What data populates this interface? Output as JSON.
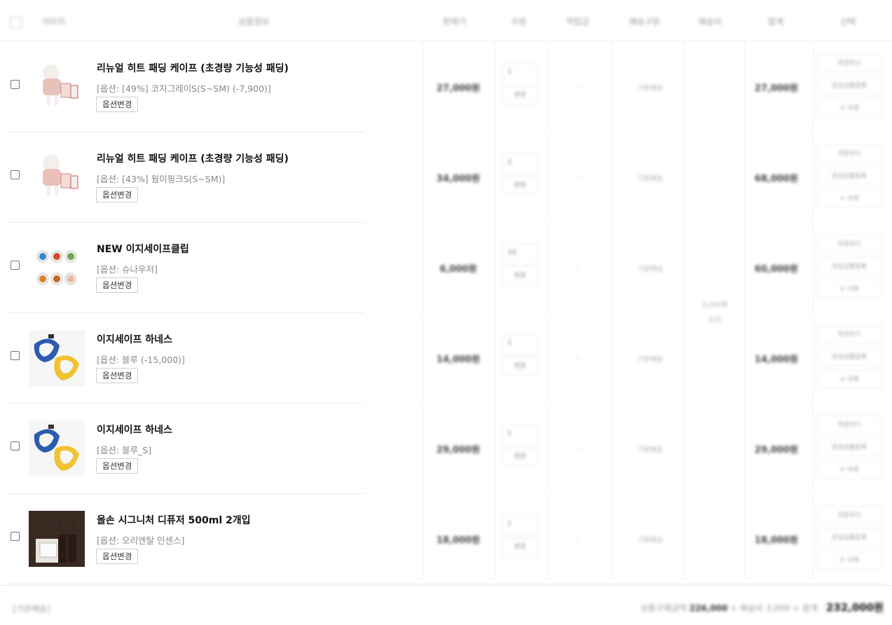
{
  "header": {
    "col_image": "이미지",
    "col_product": "상품정보",
    "col_price": "판매가",
    "col_qty": "수량",
    "col_points": "적립금",
    "col_delivery": "배송구분",
    "col_fee": "배송비",
    "col_total": "합계",
    "col_select": "선택"
  },
  "rows": [
    {
      "name": "리뉴얼 히트 패딩 케이프 (초경량 기능성 패딩)",
      "option": "[옵션: [49%] 코지그레이S(S~SM) (-7,900)]",
      "option_btn": "옵션변경",
      "price": "27,000원",
      "qty": "1",
      "qty_btn": "변경",
      "points": "-",
      "delivery": "기본배송",
      "total": "27,000원",
      "act_order": "주문하기",
      "act_wish": "관심상품등록",
      "act_delete": "✕ 삭제"
    },
    {
      "name": "리뉴얼 히트 패딩 케이프 (초경량 기능성 패딩)",
      "option": "[옵션: [43%] 웜미핑크S(S~SM)]",
      "option_btn": "옵션변경",
      "price": "34,000원",
      "qty": "2",
      "qty_btn": "변경",
      "points": "-",
      "delivery": "기본배송",
      "total": "68,000원",
      "act_order": "주문하기",
      "act_wish": "관심상품등록",
      "act_delete": "✕ 삭제"
    },
    {
      "name": "NEW 이지세이프클립",
      "option": "[옵션: 슈나우저]",
      "option_btn": "옵션변경",
      "price": "6,000원",
      "qty": "10",
      "qty_btn": "변경",
      "points": "-",
      "delivery": "기본배송",
      "total": "60,000원",
      "act_order": "주문하기",
      "act_wish": "관심상품등록",
      "act_delete": "✕ 삭제"
    },
    {
      "name": "이지세이프 하네스",
      "option": "[옵션: 블루 (-15,000)]",
      "option_btn": "옵션변경",
      "price": "14,000원",
      "qty": "1",
      "qty_btn": "변경",
      "points": "-",
      "delivery": "기본배송",
      "total": "14,000원",
      "act_order": "주문하기",
      "act_wish": "관심상품등록",
      "act_delete": "✕ 삭제"
    },
    {
      "name": "이지세이프 하네스",
      "option": "[옵션: 블루_S]",
      "option_btn": "옵션변경",
      "price": "29,000원",
      "qty": "1",
      "qty_btn": "변경",
      "points": "-",
      "delivery": "기본배송",
      "total": "29,000원",
      "act_order": "주문하기",
      "act_wish": "관심상품등록",
      "act_delete": "✕ 삭제"
    },
    {
      "name": "올손 시그니처 디퓨저 500ml 2개입",
      "option": "[옵션: 오리엔탈 인센스]",
      "option_btn": "옵션변경",
      "price": "18,000원",
      "qty": "1",
      "qty_btn": "변경",
      "points": "-",
      "delivery": "기본배송",
      "total": "18,000원",
      "act_order": "주문하기",
      "act_wish": "관심상품등록",
      "act_delete": "✕ 삭제"
    }
  ],
  "fee": {
    "line1": "3,000원",
    "line2": "조건"
  },
  "footer": {
    "left": "[기본배송]",
    "subtotal_label": "상품구매금액",
    "subtotal_value": "226,000",
    "shipping_text": "+ 배송비 3,000 = 합계 :",
    "total_value": "232,000원"
  },
  "colors": {
    "border": "#ececec",
    "text": "#111111",
    "muted": "#888888"
  },
  "icons": [
    "checkbox-icon",
    "close-icon"
  ]
}
